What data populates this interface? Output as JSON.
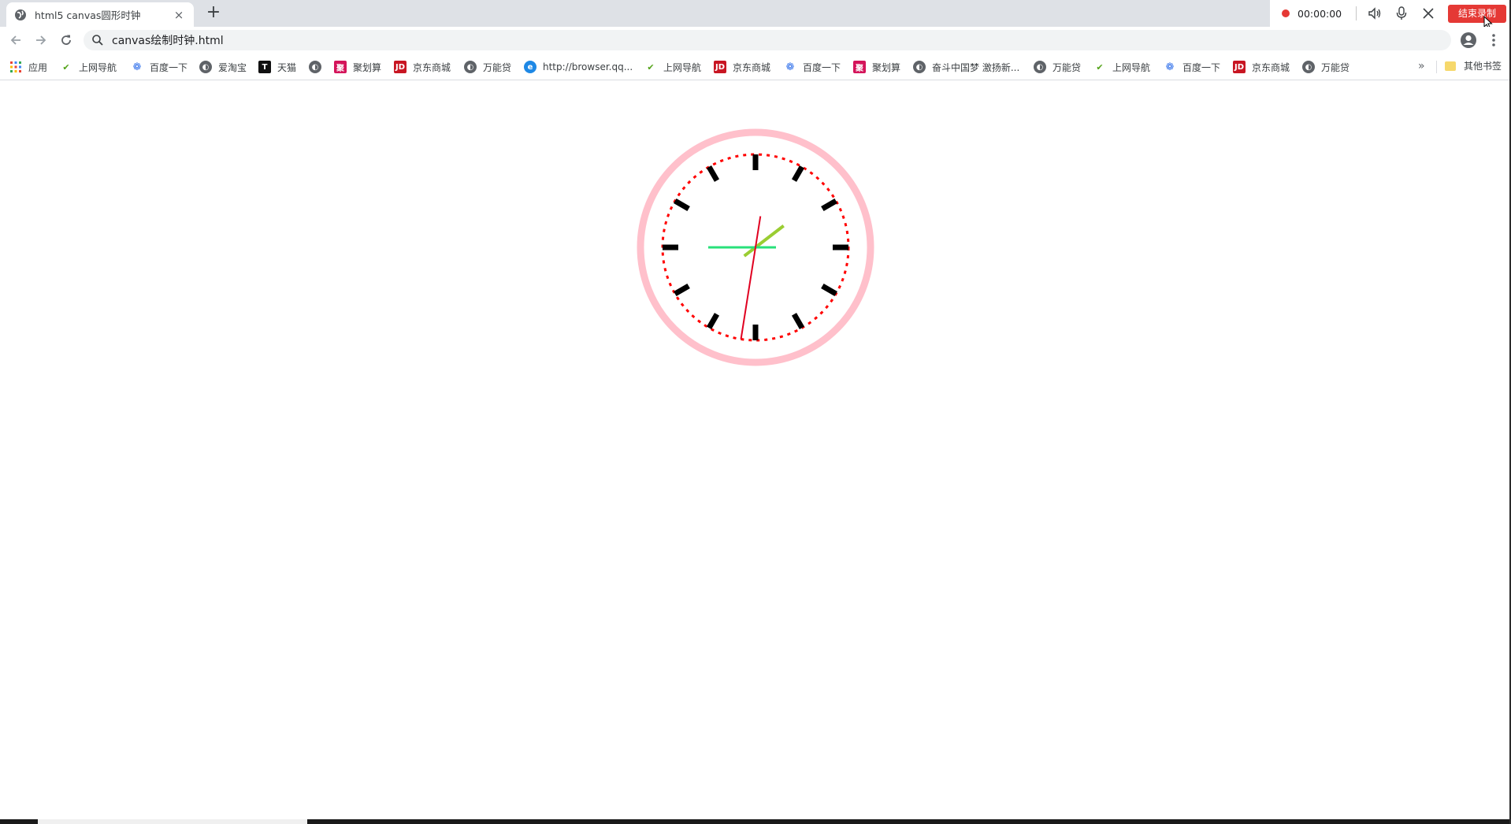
{
  "tab": {
    "title": "html5 canvas圆形时钟",
    "close": "×"
  },
  "new_tab": "+",
  "recording": {
    "time": "00:00:00",
    "stop_label": "结束录制"
  },
  "address": {
    "url": "canvas绘制时钟.html"
  },
  "bookmarks": [
    {
      "label": "应用",
      "icon": "apps-grid-icon"
    },
    {
      "label": "上网导航",
      "icon": "hao123-icon"
    },
    {
      "label": "百度一下",
      "icon": "baidu-paw-icon"
    },
    {
      "label": "爱淘宝",
      "icon": "globe-icon"
    },
    {
      "label": "天猫",
      "icon": "tmall-icon"
    },
    {
      "label": "",
      "icon": "globe-icon"
    },
    {
      "label": "聚划算",
      "icon": "juhuasuan-icon"
    },
    {
      "label": "京东商城",
      "icon": "jd-icon"
    },
    {
      "label": "万能贷",
      "icon": "globe-icon"
    },
    {
      "label": "http://browser.qq...",
      "icon": "qq-browser-icon"
    },
    {
      "label": "上网导航",
      "icon": "hao123-icon"
    },
    {
      "label": "京东商城",
      "icon": "jd-icon"
    },
    {
      "label": "百度一下",
      "icon": "baidu-paw-icon"
    },
    {
      "label": "聚划算",
      "icon": "juhuasuan-icon"
    },
    {
      "label": "奋斗中国梦 激扬新...",
      "icon": "globe-icon"
    },
    {
      "label": "万能贷",
      "icon": "globe-icon"
    },
    {
      "label": "上网导航",
      "icon": "hao123-icon"
    },
    {
      "label": "百度一下",
      "icon": "baidu-paw-icon"
    },
    {
      "label": "京东商城",
      "icon": "jd-icon"
    },
    {
      "label": "万能贷",
      "icon": "globe-icon"
    }
  ],
  "bookmarks_more": "»",
  "other_bookmarks": "其他书签",
  "clock": {
    "hour": 1,
    "minute": 45,
    "second": 31.5,
    "outer_ring_color": "#ffc0cb",
    "dial_color": "#ff0000",
    "tick_color": "#000000",
    "hour_hand_color": "#9acd32",
    "minute_hand_color": "#28e07a",
    "second_hand_color": "#e00020"
  },
  "colors": {
    "record_red": "#e53935",
    "tabstrip": "#dee1e6",
    "omnibox": "#f1f3f4"
  }
}
